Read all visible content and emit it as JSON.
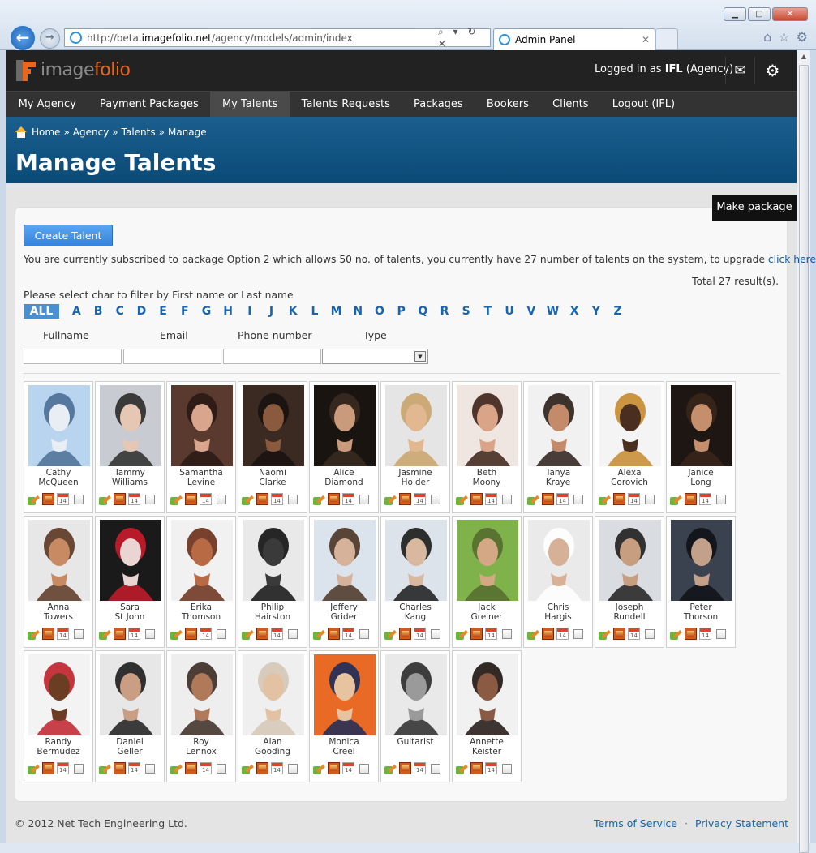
{
  "browser": {
    "url_prefix": "http://beta.",
    "url_domain": "imagefolio.net",
    "url_path": "/agency/models/admin/index",
    "tab_title": "Admin Panel",
    "addr_controls": "⌕ ▾ ↻ ✕"
  },
  "brand": {
    "name_part1": "image",
    "name_part2": "folio"
  },
  "header": {
    "logged_in_prefix": "Logged in as ",
    "logged_in_user": "IFL",
    "logged_in_suffix": " (Agency)"
  },
  "menu": [
    {
      "label": "My Agency"
    },
    {
      "label": "Payment Packages"
    },
    {
      "label": "My Talents"
    },
    {
      "label": "Talents Requests"
    },
    {
      "label": "Packages"
    },
    {
      "label": "Bookers"
    },
    {
      "label": "Clients"
    },
    {
      "label": "Logout (IFL)"
    }
  ],
  "breadcrumb": {
    "home": "Home",
    "sep": "»",
    "agency": "Agency",
    "talents": "Talents",
    "current": "Manage"
  },
  "page_title": "Manage Talents",
  "make_package_label": "Make package",
  "create_talent_label": "Create Talent",
  "subscription_text": "You are currently subscribed to package Option 2 which allows 50 no. of talents, you currently have 27 number of talents on the system, to upgrade ",
  "subscription_link": "click here",
  "total_results": "Total 27 result(s).",
  "filter_hint": "Please select char to filter by First name or Last name",
  "letters": [
    "ALL",
    "A",
    "B",
    "C",
    "D",
    "E",
    "F",
    "G",
    "H",
    "I",
    "J",
    "K",
    "L",
    "M",
    "N",
    "O",
    "P",
    "Q",
    "R",
    "S",
    "T",
    "U",
    "V",
    "W",
    "X",
    "Y",
    "Z"
  ],
  "columns": {
    "fullname": "Fullname",
    "email": "Email",
    "phone": "Phone number",
    "type": "Type"
  },
  "calendar_day": "14",
  "talents": [
    {
      "first": "Cathy",
      "last": "McQueen"
    },
    {
      "first": "Tammy",
      "last": "Williams"
    },
    {
      "first": "Samantha",
      "last": "Levine"
    },
    {
      "first": "Naomi",
      "last": "Clarke"
    },
    {
      "first": "Alice",
      "last": "Diamond"
    },
    {
      "first": "Jasmine",
      "last": "Holder"
    },
    {
      "first": "Beth",
      "last": "Moony"
    },
    {
      "first": "Tanya",
      "last": "Kraye"
    },
    {
      "first": "Alexa",
      "last": "Corovich"
    },
    {
      "first": "Janice",
      "last": "Long"
    },
    {
      "first": "Anna",
      "last": "Towers"
    },
    {
      "first": "Sara",
      "last": "St John"
    },
    {
      "first": "Erika",
      "last": "Thomson"
    },
    {
      "first": "Philip",
      "last": "Hairston"
    },
    {
      "first": "Jeffery",
      "last": "Grider"
    },
    {
      "first": "Charles",
      "last": "Kang"
    },
    {
      "first": "Jack",
      "last": "Greiner"
    },
    {
      "first": "Chris",
      "last": "Hargis"
    },
    {
      "first": "Joseph",
      "last": "Rundell"
    },
    {
      "first": "Peter",
      "last": "Thorson"
    },
    {
      "first": "Randy",
      "last": "Bermudez"
    },
    {
      "first": "Daniel",
      "last": "Geller"
    },
    {
      "first": "Roy",
      "last": "Lennox"
    },
    {
      "first": "Alan",
      "last": "Gooding"
    },
    {
      "first": "Monica",
      "last": "Creel"
    },
    {
      "first": "Guitarist",
      "last": ""
    },
    {
      "first": "Annette",
      "last": "Keister"
    }
  ],
  "photo_colors": [
    [
      "#b9d4ee",
      "#e9eef5",
      "#4b6e95"
    ],
    [
      "#c8ccd2",
      "#e5c7b4",
      "#2a2a2a"
    ],
    [
      "#5a3a2e",
      "#d9a58d",
      "#2a1a15"
    ],
    [
      "#3b2a22",
      "#8a5a3f",
      "#1a1210"
    ],
    [
      "#1a1411",
      "#c99a7c",
      "#3a2a20"
    ],
    [
      "#e5e5e5",
      "#e1b890",
      "#c9a36a"
    ],
    [
      "#efe6e1",
      "#d9a488",
      "#3d2117"
    ],
    [
      "#f1f1f1",
      "#c48b6b",
      "#2a1d17"
    ],
    [
      "#f4f4f4",
      "#4a2e20",
      "#c58a2e"
    ],
    [
      "#1d1612",
      "#c58e6d",
      "#3a261b"
    ],
    [
      "#e7e7e7",
      "#c88a62",
      "#5a3520"
    ],
    [
      "#1a1a1a",
      "#e9d5d1",
      "#c91c2b"
    ],
    [
      "#f1f1f1",
      "#b86a45",
      "#6a2e18"
    ],
    [
      "#e9e9e9",
      "#3a3a3a",
      "#111111"
    ],
    [
      "#dbe4ec",
      "#d6b29a",
      "#4a3324"
    ],
    [
      "#dde3ea",
      "#d9b8a0",
      "#1a1a1a"
    ],
    [
      "#7fb24a",
      "#d4a884",
      "#556b2f"
    ],
    [
      "#eaeaea",
      "#d6b097",
      "#ffffff"
    ],
    [
      "#d9dde2",
      "#c79e80",
      "#1e1e1e"
    ],
    [
      "#39424e",
      "#c3a08a",
      "#0f1217"
    ],
    [
      "#f3f3f3",
      "#6b3e24",
      "#c0202a"
    ],
    [
      "#e7e7e7",
      "#c99e82",
      "#1c1c1c"
    ],
    [
      "#eeeeee",
      "#b07a5a",
      "#3a2a22"
    ],
    [
      "#efefef",
      "#e3c2a4",
      "#d4c7b6"
    ],
    [
      "#e86a24",
      "#e8c3a0",
      "#1d2c5a"
    ],
    [
      "#e9e9e9",
      "#9a9a9a",
      "#2a2a2a"
    ],
    [
      "#f1f1f1",
      "#8a5a43",
      "#1e1410"
    ]
  ],
  "footer": {
    "copyright": "© 2012 Net Tech Engineering Ltd.",
    "terms": "Terms of Service",
    "sep": "·",
    "privacy": "Privacy Statement"
  },
  "icons": {
    "back": "back-arrow-icon",
    "forward": "forward-arrow-icon",
    "mail": "envelope-icon",
    "settings": "gear-icon",
    "home": "home-icon",
    "edit": "edit-icon",
    "gallery": "gallery-icon",
    "calendar": "calendar-icon"
  }
}
